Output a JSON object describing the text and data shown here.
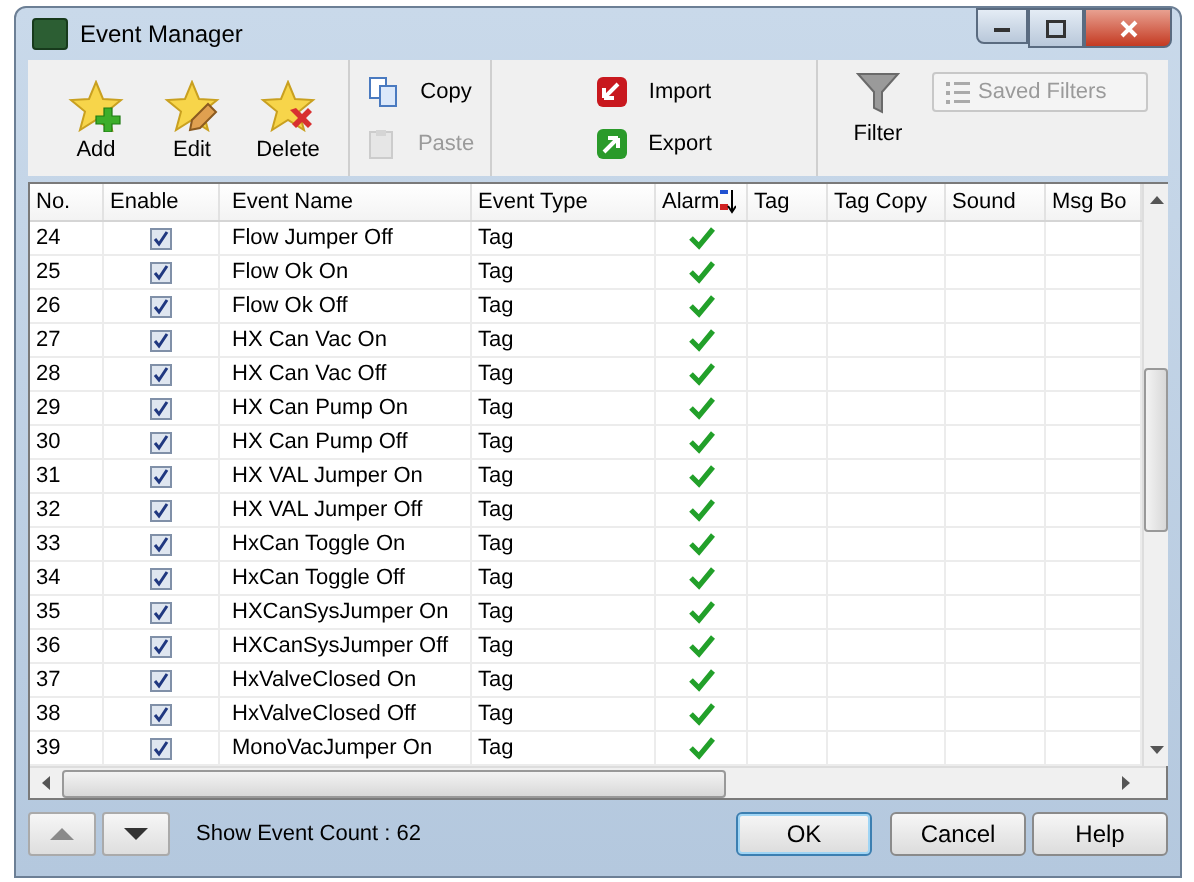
{
  "window": {
    "title": "Event Manager"
  },
  "toolbar": {
    "large_buttons": [
      {
        "label": "Add",
        "kind": "add"
      },
      {
        "label": "Edit",
        "kind": "edit"
      },
      {
        "label": "Delete",
        "kind": "delete"
      }
    ],
    "clipboard": [
      {
        "label": "Copy",
        "kind": "copy",
        "disabled": false
      },
      {
        "label": "Paste",
        "kind": "paste",
        "disabled": true
      }
    ],
    "transfer": [
      {
        "label": "Import",
        "kind": "import"
      },
      {
        "label": "Export",
        "kind": "export"
      }
    ],
    "filter": {
      "label": "Filter"
    },
    "saved_filters": {
      "label": "Saved Filters",
      "disabled": true
    }
  },
  "table": {
    "columns": [
      {
        "label": "No.",
        "sorted": false
      },
      {
        "label": "Enable",
        "sorted": false
      },
      {
        "label": "Event Name",
        "sorted": false
      },
      {
        "label": "Event Type",
        "sorted": false
      },
      {
        "label": "Alarm",
        "sorted": true
      },
      {
        "label": "Tag",
        "sorted": false
      },
      {
        "label": "Tag Copy",
        "sorted": false
      },
      {
        "label": "Sound",
        "sorted": false
      },
      {
        "label": "Msg Bo",
        "sorted": false
      }
    ],
    "rows": [
      {
        "no": "24",
        "enabled": true,
        "name": "Flow Jumper Off",
        "type": "Tag",
        "alarm": true
      },
      {
        "no": "25",
        "enabled": true,
        "name": "Flow Ok On",
        "type": "Tag",
        "alarm": true
      },
      {
        "no": "26",
        "enabled": true,
        "name": "Flow Ok Off",
        "type": "Tag",
        "alarm": true
      },
      {
        "no": "27",
        "enabled": true,
        "name": "HX Can Vac On",
        "type": "Tag",
        "alarm": true
      },
      {
        "no": "28",
        "enabled": true,
        "name": "HX Can Vac Off",
        "type": "Tag",
        "alarm": true
      },
      {
        "no": "29",
        "enabled": true,
        "name": "HX Can Pump On",
        "type": "Tag",
        "alarm": true
      },
      {
        "no": "30",
        "enabled": true,
        "name": "HX Can Pump Off",
        "type": "Tag",
        "alarm": true
      },
      {
        "no": "31",
        "enabled": true,
        "name": "HX VAL Jumper On",
        "type": "Tag",
        "alarm": true
      },
      {
        "no": "32",
        "enabled": true,
        "name": "HX VAL Jumper Off",
        "type": "Tag",
        "alarm": true
      },
      {
        "no": "33",
        "enabled": true,
        "name": "HxCan Toggle On",
        "type": "Tag",
        "alarm": true
      },
      {
        "no": "34",
        "enabled": true,
        "name": "HxCan Toggle Off",
        "type": "Tag",
        "alarm": true
      },
      {
        "no": "35",
        "enabled": true,
        "name": "HXCanSysJumper On",
        "type": "Tag",
        "alarm": true
      },
      {
        "no": "36",
        "enabled": true,
        "name": "HXCanSysJumper Off",
        "type": "Tag",
        "alarm": true
      },
      {
        "no": "37",
        "enabled": true,
        "name": "HxValveClosed On",
        "type": "Tag",
        "alarm": true
      },
      {
        "no": "38",
        "enabled": true,
        "name": "HxValveClosed Off",
        "type": "Tag",
        "alarm": true
      },
      {
        "no": "39",
        "enabled": true,
        "name": "MonoVacJumper On",
        "type": "Tag",
        "alarm": true
      }
    ]
  },
  "footer": {
    "count": "Show Event Count : 62",
    "buttons": [
      {
        "label": "OK",
        "default": true
      },
      {
        "label": "Cancel",
        "default": false
      },
      {
        "label": "Help",
        "default": false
      }
    ]
  }
}
